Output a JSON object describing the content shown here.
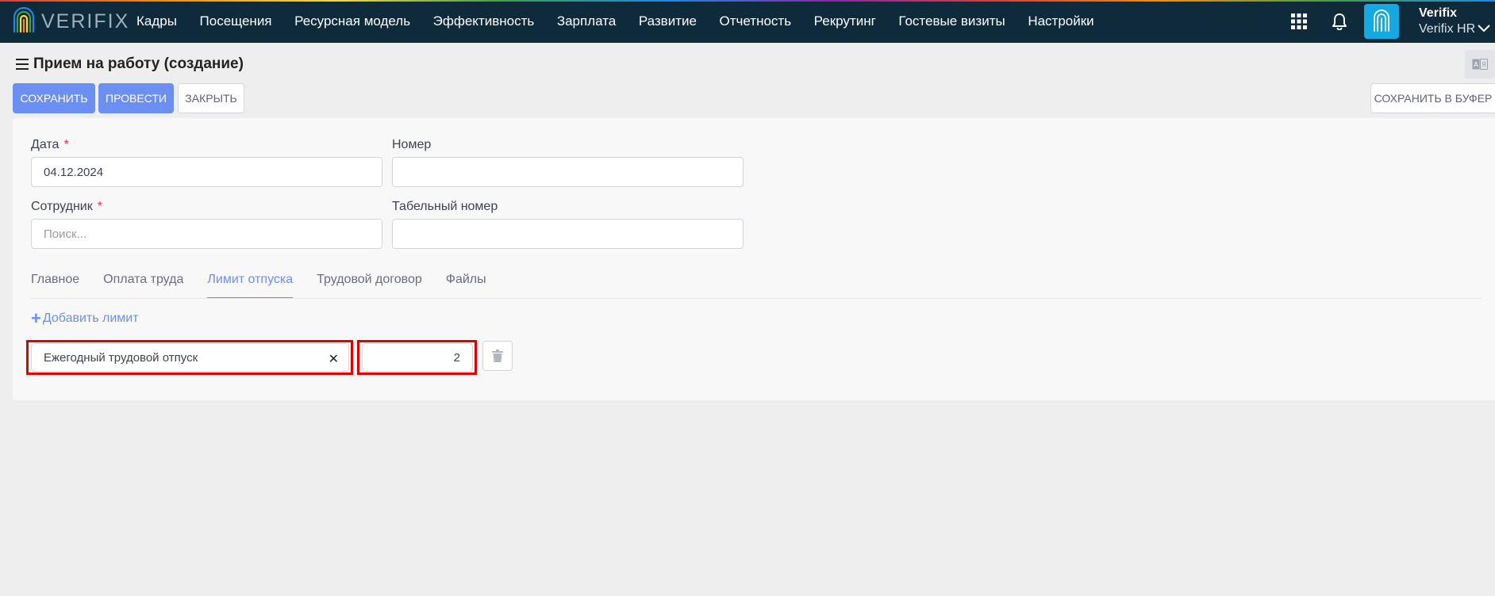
{
  "app": {
    "logo_text": "VERIFIX",
    "menu": [
      "Кадры",
      "Посещения",
      "Ресурсная модель",
      "Эффективность",
      "Зарплата",
      "Развитие",
      "Отчетность",
      "Рекрутинг",
      "Гостевые визиты",
      "Настройки"
    ],
    "user": {
      "name": "Verifix",
      "company": "Verifix HR"
    },
    "icons": {
      "apps": "grid-icon",
      "notifications": "bell-icon",
      "avatar": "fingerprint-icon",
      "user_menu": "chevron-down-icon"
    },
    "colors": {
      "navbar": "#0e2a3b",
      "primary": "#6b8ff2",
      "avatar": "#16a8e1",
      "highlight": "#e00000",
      "required": "#e53935"
    }
  },
  "page": {
    "title": "Прием на работу (создание)",
    "toolbar": {
      "save": "СОХРАНИТЬ",
      "post": "ПРОВЕСТИ",
      "close": "ЗАКРЫТЬ",
      "save_to_buffer": "СОХРАНИТЬ В БУФЕР"
    }
  },
  "form": {
    "date": {
      "label": "Дата",
      "required_mark": "*",
      "value": "04.12.2024"
    },
    "number": {
      "label": "Номер",
      "value": ""
    },
    "employee": {
      "label": "Сотрудник",
      "required_mark": "*",
      "value": "",
      "placeholder": "Поиск..."
    },
    "tab_number": {
      "label": "Табельный номер",
      "value": ""
    }
  },
  "tabs": [
    {
      "label": "Главное",
      "active": false
    },
    {
      "label": "Оплата труда",
      "active": false
    },
    {
      "label": "Лимит отпуска",
      "active": true
    },
    {
      "label": "Трудовой договор",
      "active": false
    },
    {
      "label": "Файлы",
      "active": false
    }
  ],
  "vacation_limit": {
    "add_label": "Добавить лимит",
    "add_icon": "+",
    "rows": [
      {
        "type": "Ежегодный трудовой отпуск",
        "clear_icon": "✕",
        "days": "2"
      }
    ]
  }
}
